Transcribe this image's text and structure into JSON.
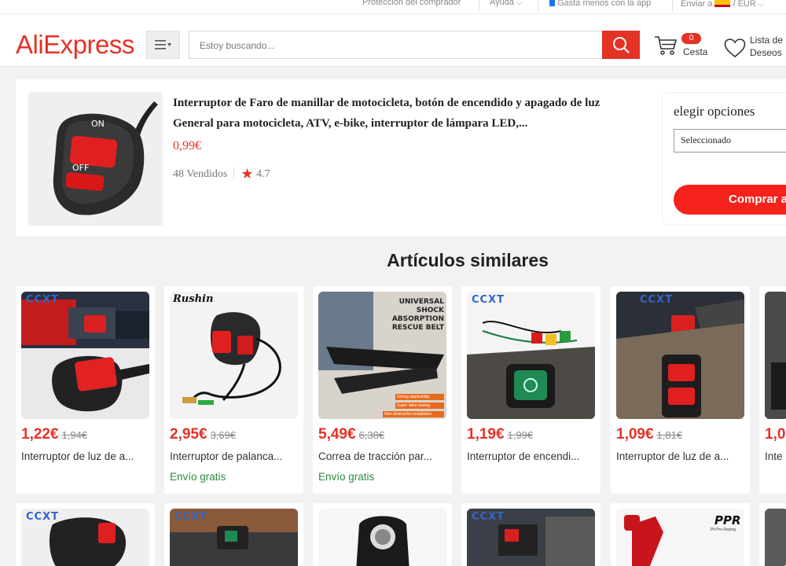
{
  "topbar": {
    "buyer_protection": "Protección del comprador",
    "help": "Ayuda",
    "app": "Gasta menos con la app",
    "ship_to": "Enviar a",
    "currency": "EUR"
  },
  "header": {
    "logo": "AliExpress",
    "search_placeholder": "Estoy buscando...",
    "cart_count": "0",
    "cart_label": "Cesta",
    "wishlist_line1": "Lista de",
    "wishlist_line2": "Deseos"
  },
  "product": {
    "title": "Interruptor de Faro de manillar de motocicleta, botón de encendido y apagado de luz General para motocicleta, ATV, e-bike, interruptor de lámpara LED,...",
    "price": "0,99€",
    "sold": "48 Vendidos",
    "rating": "4.7",
    "switch_on": "ON",
    "switch_off": "OFF"
  },
  "options": {
    "title": "elegir opciones",
    "selected": "Seleccionado",
    "buy_label": "Comprar a"
  },
  "similar": {
    "title": "Artículos similares",
    "items": [
      {
        "price": "1,22€",
        "old": "1,94€",
        "name": "Interruptor de luz de a...",
        "ship": "",
        "brand": "CCXT"
      },
      {
        "price": "2,95€",
        "old": "3,69€",
        "name": "Interruptor de palanca...",
        "ship": "Envío gratis",
        "brand": "Rushin"
      },
      {
        "price": "5,49€",
        "old": "6,38€",
        "name": "Correa de tracción par...",
        "ship": "Envío gratis",
        "brand": "UNIVERSAL SHOCK ABSORPTION RESCUE BELT"
      },
      {
        "price": "1,19€",
        "old": "1,99€",
        "name": "Interruptor de encendi...",
        "ship": "",
        "brand": "CCXT"
      },
      {
        "price": "1,09€",
        "old": "1,81€",
        "name": "Interruptor de luz de a...",
        "ship": "",
        "brand": "CCXT"
      },
      {
        "price": "1,0",
        "old": "",
        "name": "Inte",
        "ship": "",
        "brand": ""
      }
    ],
    "belt_tags": [
      "Strong applicability",
      "Super labor-saving",
      "Non-destructive installation"
    ],
    "row2_brands": [
      "CCXT",
      "CCXT",
      "",
      "CCXT",
      "PPR"
    ],
    "row2_sublabel": "Pit Pro Racing"
  }
}
